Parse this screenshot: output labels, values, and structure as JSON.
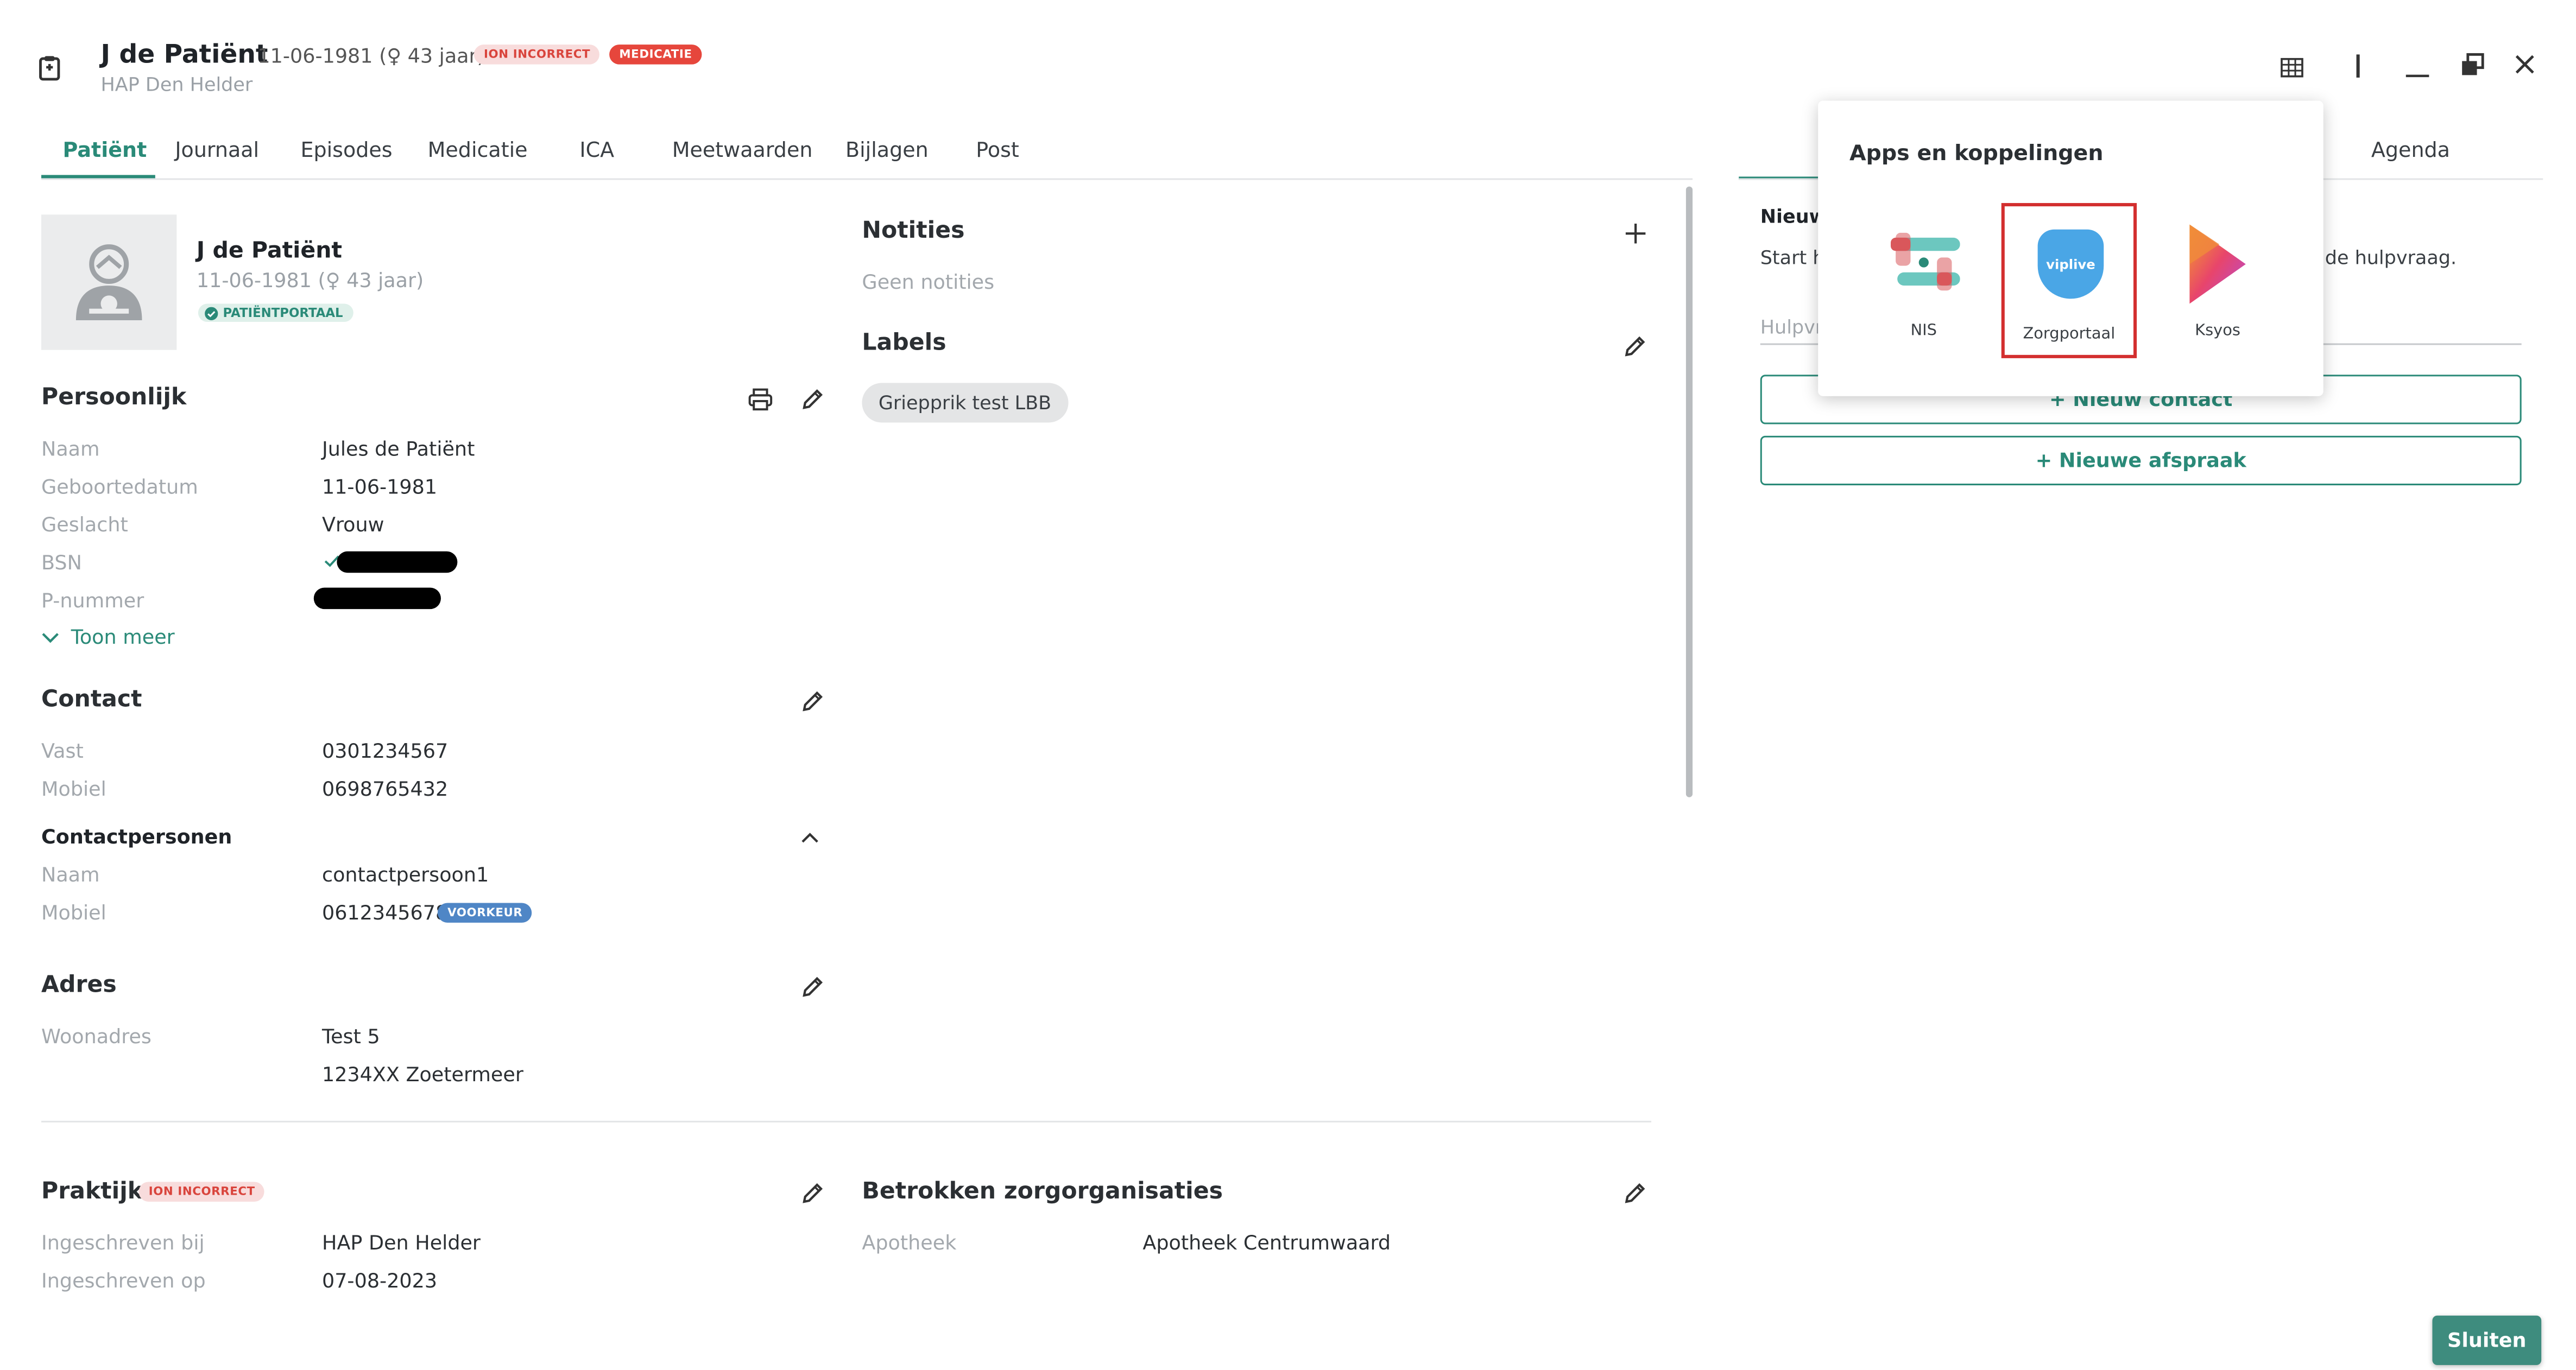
{
  "header": {
    "patient_name": "J de Patiënt",
    "dob_age": "11-06-1981 (♀ 43 jaar)",
    "badges": [
      "ION INCORRECT",
      "MEDICATIE"
    ],
    "practice": "HAP Den Helder"
  },
  "tabs": [
    "Patiënt",
    "Journaal",
    "Episodes",
    "Medicatie",
    "ICA",
    "Meetwaarden",
    "Bijlagen",
    "Post"
  ],
  "active_tab": "Patiënt",
  "right_tabs": [
    "Agenda"
  ],
  "patient_card": {
    "name": "J de Patiënt",
    "dob_age": "11-06-1981 (♀ 43 jaar)",
    "portal_badge": "PATIËNTPORTAAL"
  },
  "persoonlijk": {
    "title": "Persoonlijk",
    "rows": [
      {
        "label": "Naam",
        "value": "Jules de Patiënt"
      },
      {
        "label": "Geboortedatum",
        "value": "11-06-1981"
      },
      {
        "label": "Geslacht",
        "value": "Vrouw"
      },
      {
        "label": "BSN",
        "value": ""
      },
      {
        "label": "P-nummer",
        "value": ""
      }
    ],
    "toon_meer": "Toon meer"
  },
  "contact": {
    "title": "Contact",
    "rows": [
      {
        "label": "Vast",
        "value": "0301234567"
      },
      {
        "label": "Mobiel",
        "value": "0698765432"
      }
    ]
  },
  "contactpersonen": {
    "title": "Contactpersonen",
    "rows": [
      {
        "label": "Naam",
        "value": "contactpersoon1"
      },
      {
        "label": "Mobiel",
        "value": "0612345678"
      }
    ],
    "voorkeur_badge": "VOORKEUR"
  },
  "adres": {
    "title": "Adres",
    "label": "Woonadres",
    "line1": "Test 5",
    "line2": "1234XX Zoetermeer"
  },
  "praktijk": {
    "title": "Praktijk",
    "badge": "ION INCORRECT",
    "rows": [
      {
        "label": "Ingeschreven bij",
        "value": "HAP Den Helder"
      },
      {
        "label": "Ingeschreven op",
        "value": "07-08-2023"
      }
    ]
  },
  "notities": {
    "title": "Notities",
    "empty": "Geen notities"
  },
  "labels": {
    "title": "Labels",
    "chip": "Griepprik test LBB"
  },
  "betrokken": {
    "title": "Betrokken zorgorganisaties",
    "label": "Apotheek",
    "value": "Apotheek Centrumwaard"
  },
  "right_panel": {
    "title_partial": "Nieuw",
    "text_partial_left": "Start h",
    "text_partial_right": "de hulpvraag.",
    "input_partial": "Hulpvr",
    "btn_contact": "+ Nieuw contact",
    "btn_afspraak": "+ Nieuwe afspraak"
  },
  "apps_popup": {
    "title": "Apps en koppelingen",
    "apps": [
      {
        "name": "NIS",
        "icon": "nis-logo-icon"
      },
      {
        "name": "Zorgportaal",
        "icon": "viplive-logo-icon",
        "logo_text": "viplive"
      },
      {
        "name": "Ksyos",
        "icon": "ksyos-logo-icon"
      }
    ]
  },
  "footer": {
    "close_button": "Sluiten"
  },
  "colors": {
    "accent": "#2a8a78",
    "badge_red_bg": "#f8dcdc",
    "badge_red_text": "#d9443c",
    "medicatie_bg": "#e6463c",
    "voorkeur_bg": "#4f86c6",
    "highlight_border": "#d32f2f",
    "sluiten_bg": "#3e8c7e"
  }
}
